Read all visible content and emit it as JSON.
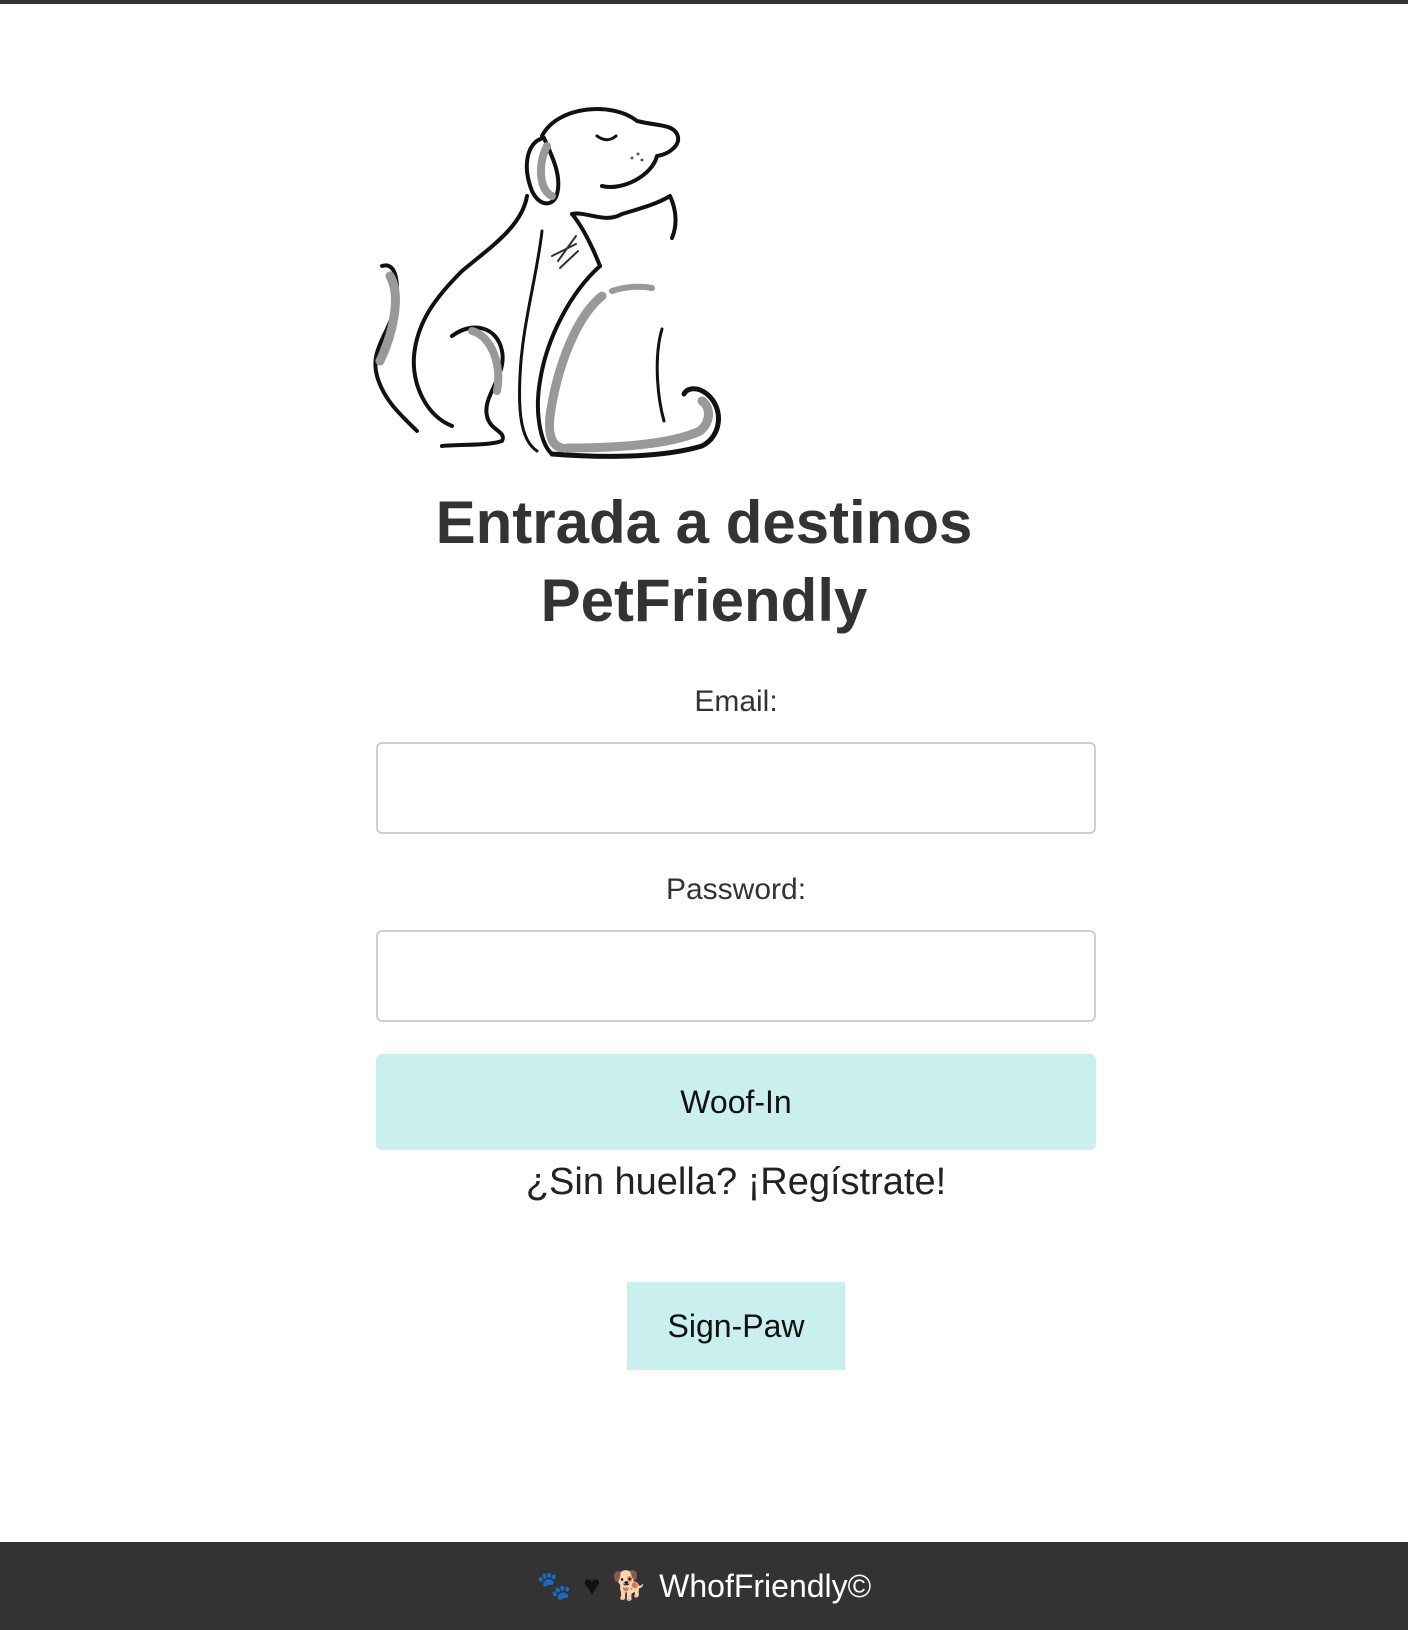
{
  "header": {
    "logo_icon": "dog-and-cat-icon",
    "title": "Entrada a destinos PetFriendly"
  },
  "form": {
    "email_label": "Email:",
    "email_value": "",
    "password_label": "Password:",
    "password_value": "",
    "submit_label": "Woof-In"
  },
  "signup": {
    "prompt": "¿Sin huella? ¡Regístrate!",
    "button_label": "Sign-Paw"
  },
  "footer": {
    "icons": [
      "paw-icon",
      "heart-icon",
      "dog-icon"
    ],
    "text": "WhofFriendly©"
  },
  "colors": {
    "button_bg": "#c9efee",
    "footer_bg": "#333333",
    "text": "#333333"
  }
}
